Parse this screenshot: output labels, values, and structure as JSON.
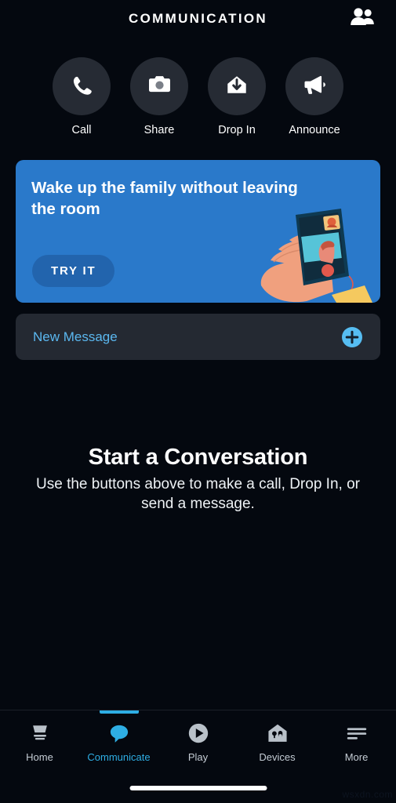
{
  "header": {
    "title": "COMMUNICATION",
    "contacts_icon": "people-icon"
  },
  "quick_actions": [
    {
      "label": "Call",
      "icon": "phone-icon"
    },
    {
      "label": "Share",
      "icon": "camera-icon"
    },
    {
      "label": "Drop In",
      "icon": "house-down-arrow-icon"
    },
    {
      "label": "Announce",
      "icon": "megaphone-icon"
    }
  ],
  "promo": {
    "title": "Wake up the family without leaving the room",
    "button_label": "TRY IT",
    "illustration": "hand-holding-phone-video-call-illustration",
    "background_color": "#2a79ca",
    "button_color": "#2264ad"
  },
  "new_message": {
    "label": "New Message",
    "add_icon": "plus-circle-icon",
    "accent_color": "#5bb8f0"
  },
  "empty_state": {
    "title": "Start a Conversation",
    "subtitle": "Use the buttons above to make a call, Drop In, or send a message."
  },
  "bottom_nav": {
    "active_index": 1,
    "active_color": "#2eaee4",
    "items": [
      {
        "label": "Home",
        "icon": "echo-device-icon"
      },
      {
        "label": "Communicate",
        "icon": "speech-bubble-icon"
      },
      {
        "label": "Play",
        "icon": "play-circle-icon"
      },
      {
        "label": "Devices",
        "icon": "smart-home-icon"
      },
      {
        "label": "More",
        "icon": "hamburger-menu-icon"
      }
    ]
  },
  "watermark": {
    "text": "wsxdn.com"
  }
}
